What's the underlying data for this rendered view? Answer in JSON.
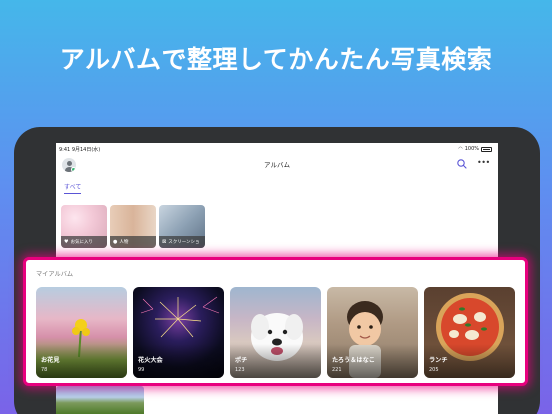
{
  "headline": "アルバムで整理してかんたん写真検索",
  "status_bar": {
    "time": "9:41 9月14日(水)",
    "battery": "100%"
  },
  "nav": {
    "title": "アルバム"
  },
  "tabs": [
    {
      "label": "すべて",
      "selected": true
    }
  ],
  "categories": [
    {
      "label": "お気に入り",
      "icon": "heart-icon",
      "count": ""
    },
    {
      "label": "人物",
      "icon": "person-icon",
      "count": ""
    },
    {
      "label": "スクリーンショ",
      "icon": "screenshot-icon",
      "count": ""
    }
  ],
  "my_albums": {
    "section_label": "マイアルバム",
    "items": [
      {
        "name": "お花見",
        "count": "78"
      },
      {
        "name": "花火大会",
        "count": "99"
      },
      {
        "name": "ポチ",
        "count": "123"
      },
      {
        "name": "たろう＆はなこ",
        "count": "221"
      },
      {
        "name": "ランチ",
        "count": "205"
      }
    ]
  },
  "colors": {
    "accent": "#5a55d6",
    "highlight": "#e8007e"
  }
}
